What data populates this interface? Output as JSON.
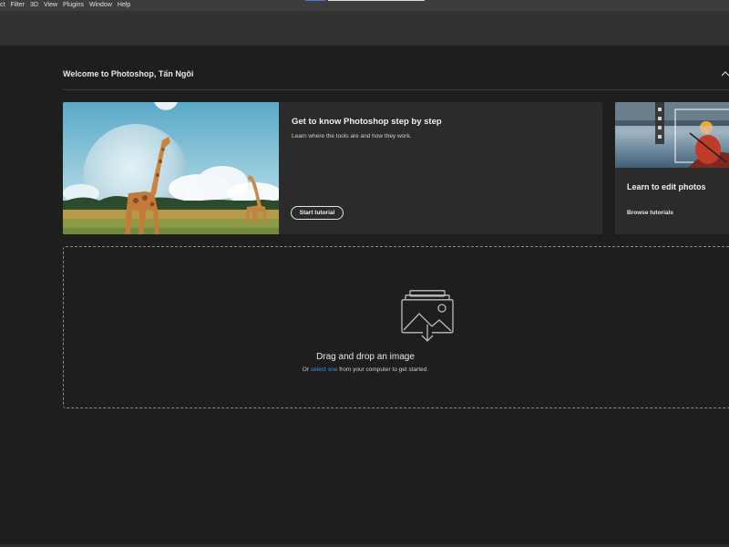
{
  "menu": {
    "items": [
      "ct",
      "Filter",
      "3D",
      "View",
      "Plugins",
      "Window",
      "Help"
    ]
  },
  "home": {
    "welcome": "Welcome to Photoshop, Tấn Ngôi",
    "collapse_icon": "chevron-up-icon",
    "tutorial_card": {
      "title": "Get to know Photoshop step by step",
      "description": "Learn where the tools are and how they work.",
      "button": "Start tutorial"
    },
    "edit_card": {
      "title": "Learn to edit photos",
      "link": "Browse tutorials"
    },
    "drop_zone": {
      "title": "Drag and drop an image",
      "prefix": "Or ",
      "link": "select one",
      "suffix": " from your computer to get started."
    }
  },
  "colors": {
    "background": "#1e1e1e",
    "menubar": "#3d3d3d",
    "card": "#2b2b2b",
    "accent_link": "#3b8ded"
  }
}
